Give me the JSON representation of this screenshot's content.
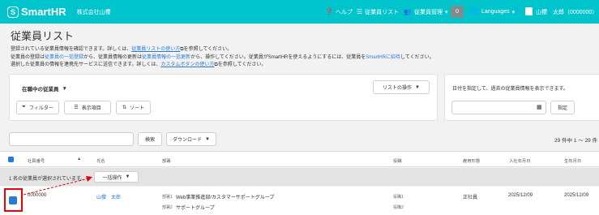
{
  "header": {
    "logo_mark": "S",
    "logo_text": "SmartHR",
    "company": "株式会社山櫻",
    "help": "ヘルプ",
    "employee_list": "従業員リスト",
    "employee_admin": "従業員管理",
    "notif_count": "0",
    "languages": "Languages",
    "user": "山櫻　太郎（0000000）"
  },
  "page": {
    "title": "従業員リスト",
    "desc1_a": "登録されている従業員情報を確認できます。詳しくは、",
    "desc1_link": "従業員リストの使い方",
    "desc1_b": "を参照してください。",
    "desc2_a": "従業員の登録は",
    "desc2_link1": "従業員の一括登録",
    "desc2_b": "から、従業員情報の更新は",
    "desc2_link2": "従業員情報の一括更新",
    "desc2_c": "から、操作してください。従業員がSmartHRを使えるようにするには、従業員を",
    "desc2_link3": "SmartHRに招待",
    "desc2_d": "してください。",
    "desc3_a": "選択した従業員の情報を連携先サービスに送信できます。詳しくは、",
    "desc3_link": "カスタムボタンの使い方",
    "desc3_b": "を参照してください。"
  },
  "filter_card": {
    "status_select": "在職中の従業員",
    "list_actions": "リストの操作",
    "filter": "フィルター",
    "display_items": "表示項目",
    "sort": "ソート"
  },
  "date_card": {
    "description": "日付を指定して、過去の従業員情報を表示できます。",
    "set_button": "指定"
  },
  "search": {
    "button": "検索",
    "download": "ダウンロード",
    "count": "29 件中 1 ～ 29 件"
  },
  "table": {
    "headers": [
      "社員番号",
      "氏名",
      "部署",
      "役職",
      "雇用形態",
      "入社年月日",
      "生年月日"
    ],
    "selected_text": "1 名の従業員が選択されています。",
    "bulk_action": "一括操作",
    "row": {
      "employee_no": "0000000",
      "name": "山櫻　太郎",
      "dept1_label": "部署1",
      "dept1": "Web事業推進部/カスタマーサポートグループ",
      "dept2_label": "部署2",
      "dept2": "サポートグループ",
      "role1": "役職1",
      "role2": "役職2",
      "employment": "正社員",
      "join_date": "2025/12/09",
      "birth_date": "2025/12/09"
    }
  },
  "colors": {
    "brand": "#00c4cc",
    "link": "#2a7bd1",
    "annotation": "#e00000"
  }
}
